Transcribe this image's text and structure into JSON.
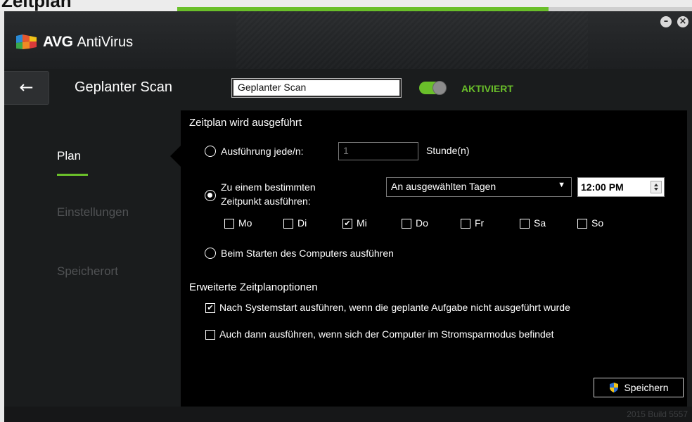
{
  "header_banner": "Zeitplan",
  "app": {
    "brand": "AVG",
    "product": "AntiVirus"
  },
  "window": {
    "minimize": "–",
    "close": "×"
  },
  "page": {
    "title": "Geplanter Scan",
    "name_value": "Geplanter Scan",
    "toggle_label": "AKTIVIERT",
    "toggle_on": true
  },
  "nav": {
    "items": [
      {
        "label": "Plan",
        "active": true
      },
      {
        "label": "Einstellungen",
        "active": false
      },
      {
        "label": "Speicherort",
        "active": false
      }
    ]
  },
  "schedule": {
    "section_title": "Zeitplan wird ausgeführt",
    "every_label": "Ausführung jede/n:",
    "every_value": "1",
    "every_unit": "Stunde(n)",
    "specific_label_line1": "Zu einem bestimmten",
    "specific_label_line2": "Zeitpunkt ausführen:",
    "selected_mode": "specific",
    "days_option": "An ausgewählten Tagen",
    "time": "12:00 PM",
    "days": [
      {
        "label": "Mo",
        "checked": false
      },
      {
        "label": "Di",
        "checked": false
      },
      {
        "label": "Mi",
        "checked": true
      },
      {
        "label": "Do",
        "checked": false
      },
      {
        "label": "Fr",
        "checked": false
      },
      {
        "label": "Sa",
        "checked": false
      },
      {
        "label": "So",
        "checked": false
      }
    ],
    "startup_label": "Beim Starten des Computers ausführen"
  },
  "advanced": {
    "section_title": "Erweiterte Zeitplanoptionen",
    "opt1_label": "Nach Systemstart ausführen, wenn die geplante Aufgabe nicht ausgeführt wurde",
    "opt1_checked": true,
    "opt2_label": "Auch dann ausführen, wenn sich der Computer im Stromsparmodus befindet",
    "opt2_checked": false
  },
  "save_label": "Speichern",
  "build": "2015  Build 5557",
  "colors": {
    "accent": "#6abf2a",
    "panel": "#000000",
    "window": "#1a1c1d"
  }
}
